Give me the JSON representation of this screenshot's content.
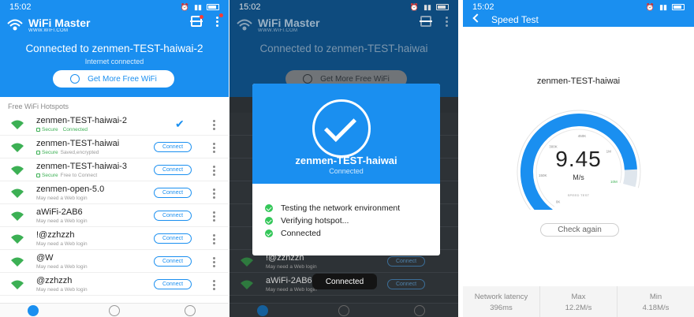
{
  "status": {
    "time": "15:02"
  },
  "app": {
    "name": "WiFi Master",
    "url": "WWW.WIFI.COM"
  },
  "home": {
    "connected_title": "Connected to zenmen-TEST-haiwai-2",
    "connected_sub": "Internet connected",
    "more_btn": "Get More Free WiFi",
    "section_label": "Free WiFi Hotspots",
    "networks": [
      {
        "name": "zenmen-TEST-haiwai-2",
        "secure": "Secure",
        "state": "Connected",
        "action": ""
      },
      {
        "name": "zenmen-TEST-haiwai",
        "secure": "Secure",
        "state": "Saved,encrypted",
        "action": "Connect"
      },
      {
        "name": "zenmen-TEST-haiwai-3",
        "secure": "Secure",
        "state": "Free to Connect",
        "action": "Connect"
      },
      {
        "name": "zenmen-open-5.0",
        "secure": "",
        "state": "May need a Web login",
        "action": "Connect"
      },
      {
        "name": "aWiFi-2AB6",
        "secure": "",
        "state": "May need a Web login",
        "action": "Connect"
      },
      {
        "name": "!@zzhzzh",
        "secure": "",
        "state": "May need a Web login",
        "action": "Connect"
      },
      {
        "name": "@W",
        "secure": "",
        "state": "May need a Web login",
        "action": "Connect"
      },
      {
        "name": "@zzhzzh",
        "secure": "",
        "state": "May need a Web login",
        "action": "Connect"
      }
    ]
  },
  "connecting": {
    "bg_title": "Connected to zenmen-TEST-haiwai",
    "more_btn": "Get More Free WiFi",
    "bg_rows": [
      {
        "name": "!@zzhzzh",
        "sub": "May need a Web login",
        "action": "Connect"
      },
      {
        "name": "aWiFi-2AB6",
        "sub": "May need a Web login",
        "action": "Connect"
      }
    ],
    "modal_ssid": "zenmen-TEST-haiwai",
    "modal_sub": "Connected",
    "steps": [
      "Testing the network environment",
      "Verifying hotspot...",
      "Connected"
    ],
    "toast": "Connected"
  },
  "speedtest": {
    "title": "Speed Test",
    "ssid": "zenmen-TEST-haiwai",
    "speed_value": "9.45",
    "speed_unit": "M/s",
    "gauge_caption": "SPEED TEST",
    "gauge_fraction": 0.93,
    "tick_labels": [
      "0K",
      "150K",
      "300K",
      "450K",
      "1M",
      "10M"
    ],
    "check_again": "Check again",
    "stats": [
      {
        "label": "Network latency",
        "value": "396ms"
      },
      {
        "label": "Max",
        "value": "12.2M/s"
      },
      {
        "label": "Min",
        "value": "4.18M/s"
      }
    ]
  },
  "colors": {
    "primary": "#1a8ff0",
    "green": "#3cb054",
    "dark_bg": "#2a2f33"
  }
}
